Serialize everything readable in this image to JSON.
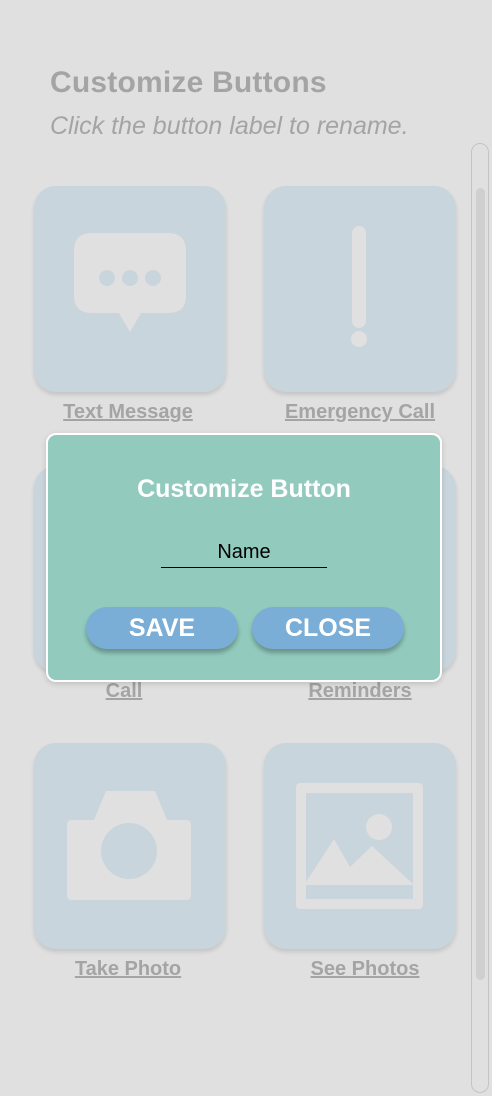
{
  "header": {
    "title": "Customize Buttons",
    "subtitle": "Click the button label to rename."
  },
  "tiles": [
    {
      "label": "Text Message",
      "icon": "chat-bubble-icon"
    },
    {
      "label": "Emergency Call",
      "icon": "exclamation-icon"
    },
    {
      "label": "Call",
      "icon": "phone-icon"
    },
    {
      "label": "Reminders",
      "icon": "bell-icon"
    },
    {
      "label": "Take Photo",
      "icon": "camera-icon"
    },
    {
      "label": "See Photos",
      "icon": "image-icon"
    }
  ],
  "dialog": {
    "title": "Customize Button",
    "input_placeholder": "Name",
    "input_value": "",
    "save_label": "SAVE",
    "close_label": "CLOSE"
  },
  "colors": {
    "background": "#e0e0e0",
    "tile": "#c9d5dc",
    "icon": "#e0e0e0",
    "dialog": "#92cbbe",
    "button": "#7aaed6",
    "muted_text": "#a4a4a4"
  }
}
